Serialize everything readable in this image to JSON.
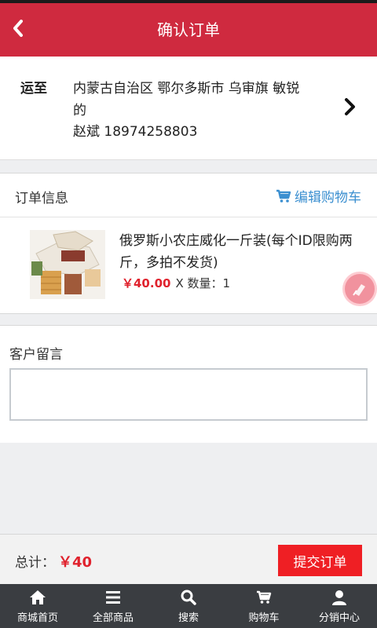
{
  "header": {
    "title": "确认订单",
    "back_icon": "chevron-left-icon"
  },
  "address": {
    "label": "运至",
    "line1": "内蒙古自治区 鄂尔多斯市 乌审旗 敏锐",
    "line2": "的",
    "line3": "赵斌 18974258803",
    "chevron_icon": "chevron-right-icon"
  },
  "order": {
    "section_title": "订单信息",
    "edit_cart_label": "编辑购物车",
    "item": {
      "name": "俄罗斯小农庄威化一斤装(每个ID限购两斤，多拍不发货)",
      "price": "￥40.00",
      "qty_text": "X 数量：1",
      "image_icon": "product-wafer-image"
    }
  },
  "memo": {
    "label": "客户留言",
    "value": "",
    "placeholder": ""
  },
  "total": {
    "label": "总计：",
    "value": "￥40",
    "submit_label": "提交订单"
  },
  "tabbar": {
    "items": [
      {
        "label": "商城首页",
        "icon": "home-icon"
      },
      {
        "label": "全部商品",
        "icon": "list-icon"
      },
      {
        "label": "搜索",
        "icon": "search-icon"
      },
      {
        "label": "购物车",
        "icon": "cart-icon"
      },
      {
        "label": "分销中心",
        "icon": "user-icon"
      }
    ]
  },
  "colors": {
    "accent": "#cf2a3f",
    "price": "#e0222d",
    "link": "#3b8fd0",
    "submit": "#ef1f24",
    "tabbar": "#3a3d41"
  }
}
